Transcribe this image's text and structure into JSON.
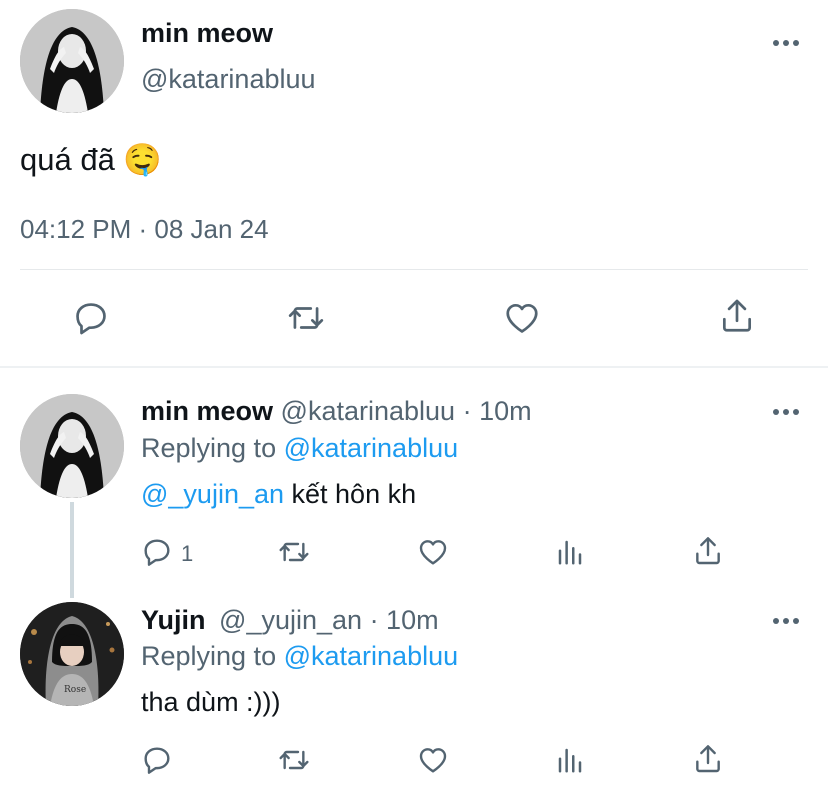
{
  "main_tweet": {
    "display_name": "min meow",
    "handle": "@katarinabluu",
    "text": "quá đã 🤤",
    "timestamp": "04:12 PM · 08 Jan 24",
    "more_icon": "more-icon",
    "actions": [
      "reply-icon",
      "retweet-icon",
      "like-icon",
      "share-icon"
    ]
  },
  "replies": [
    {
      "display_name": "min meow",
      "handle": "@katarinabluu",
      "time": "· 10m",
      "replying_prefix": "Replying to",
      "replying_handle": "@katarinabluu",
      "mention": "@_yujin_an",
      "text": " kết hôn kh",
      "reply_count": "1"
    },
    {
      "display_name": "Yujin",
      "handle": "@_yujin_an",
      "time": "· 10m",
      "replying_prefix": "Replying to",
      "replying_handle": "@katarinabluu",
      "text": "tha dùm :)))",
      "avatar_text": "Rose"
    }
  ],
  "colors": {
    "accent": "#1d9bf0",
    "secondary_text": "#536471",
    "icon": "#536471",
    "divider": "#e6e9eb"
  }
}
